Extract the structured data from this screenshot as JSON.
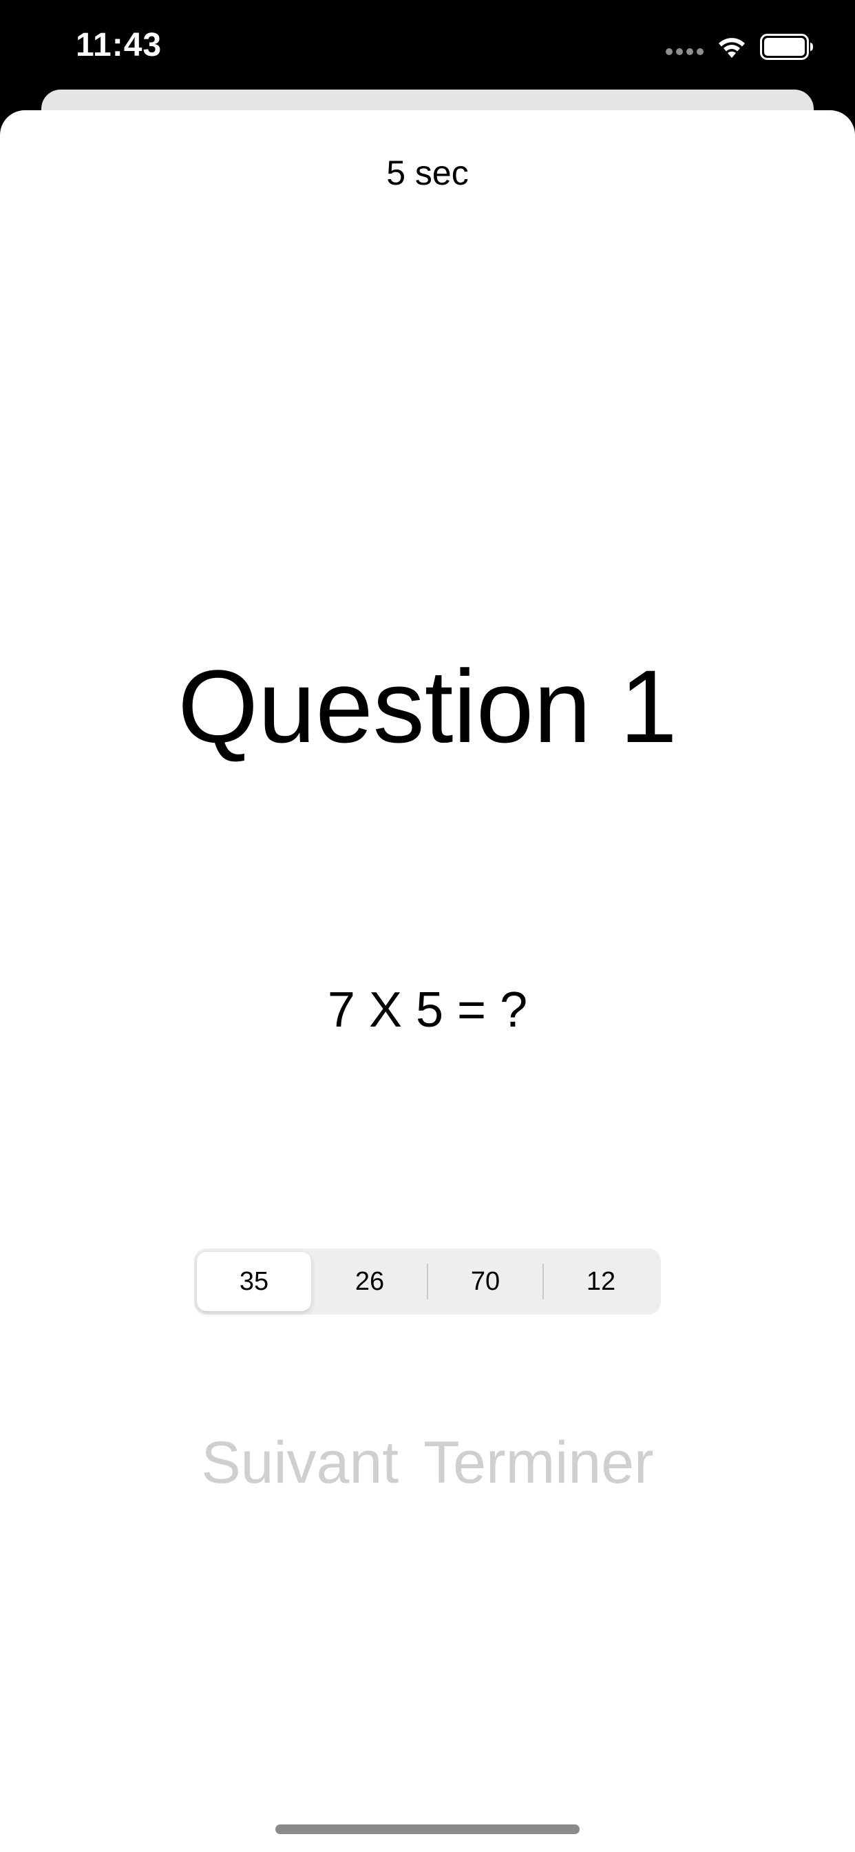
{
  "status_bar": {
    "time": "11:43"
  },
  "quiz": {
    "timer": "5 sec",
    "title": "Question 1",
    "question": "7 X 5 = ?",
    "options": [
      "35",
      "26",
      "70",
      "12"
    ],
    "selected_index": 0
  },
  "actions": {
    "next_label": "Suivant",
    "finish_label": "Terminer"
  },
  "colors": {
    "action_disabled": "#cfcfd1",
    "segment_background": "#eeeeef",
    "sheet_background": "#ffffff"
  }
}
